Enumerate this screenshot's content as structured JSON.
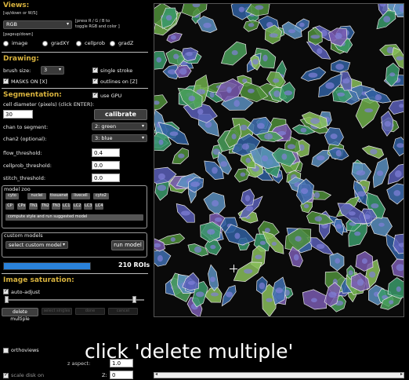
{
  "views": {
    "title": "Views:",
    "hint_updown": "[up/down or W/S]",
    "hint_pageupdown": "[pageup/down]",
    "rgb_select": "RGB",
    "toggle_hint_line1": "[press R / G / B to",
    "toggle_hint_line2": "toggle RGB and color ]",
    "radio_options": [
      "image",
      "gradXY",
      "cellprob",
      "gradZ"
    ]
  },
  "drawing": {
    "title": "Drawing:",
    "brush_label": "brush size:",
    "brush_value": "3",
    "single_stroke": "single stroke",
    "masks_on": "MASKS ON [X]",
    "outlines_on": "outlines on [Z]"
  },
  "segmentation": {
    "title": "Segmentation:",
    "use_gpu": "use GPU",
    "diameter_label": "cell diameter (pixels) (click ENTER):",
    "diameter_value": "30",
    "calibrate": "calibrate",
    "chan_label": "chan to segment:",
    "chan_value": "2: green",
    "chan2_label": "chan2 (optional):",
    "chan2_value": "3: blue",
    "flow_label": "flow_threshold:",
    "flow_value": "0.4",
    "cellprob_label": "cellprob_threshold:",
    "cellprob_value": "0.0",
    "stitch_label": "stitch_threshold:",
    "stitch_value": "0.0"
  },
  "model_zoo": {
    "title": "model zoo",
    "row1": [
      "cyto",
      "nuclei",
      "tissuenet",
      "livecell",
      "cyto2"
    ],
    "row2": [
      "CP",
      "CPx",
      "TN1",
      "TN2",
      "TN3",
      "LC1",
      "LC2",
      "LC3",
      "LC4"
    ],
    "suggest": "compute style and run suggested model"
  },
  "custom_models": {
    "title": "custom models",
    "select": "select custom model",
    "run": "run model"
  },
  "progress": {
    "value": 1.0,
    "rois": "210 ROIs"
  },
  "saturation": {
    "title": "Image saturation:",
    "auto_adjust": "auto-adjust",
    "slider_low": 0.0,
    "slider_high": 1.0
  },
  "bottom_buttons": [
    "delete multiple",
    "select singles",
    "done",
    "cancel"
  ],
  "orthoviews": "orthoviews",
  "scale_disk": "scale disk on",
  "zaspect_label": "z aspect:",
  "zaspect_value": "1.0",
  "z_label": "Z:",
  "z_value": "0",
  "caption": "click 'delete multiple'",
  "colors": {
    "section": "#d9b33e",
    "progress": "#2a82da"
  }
}
